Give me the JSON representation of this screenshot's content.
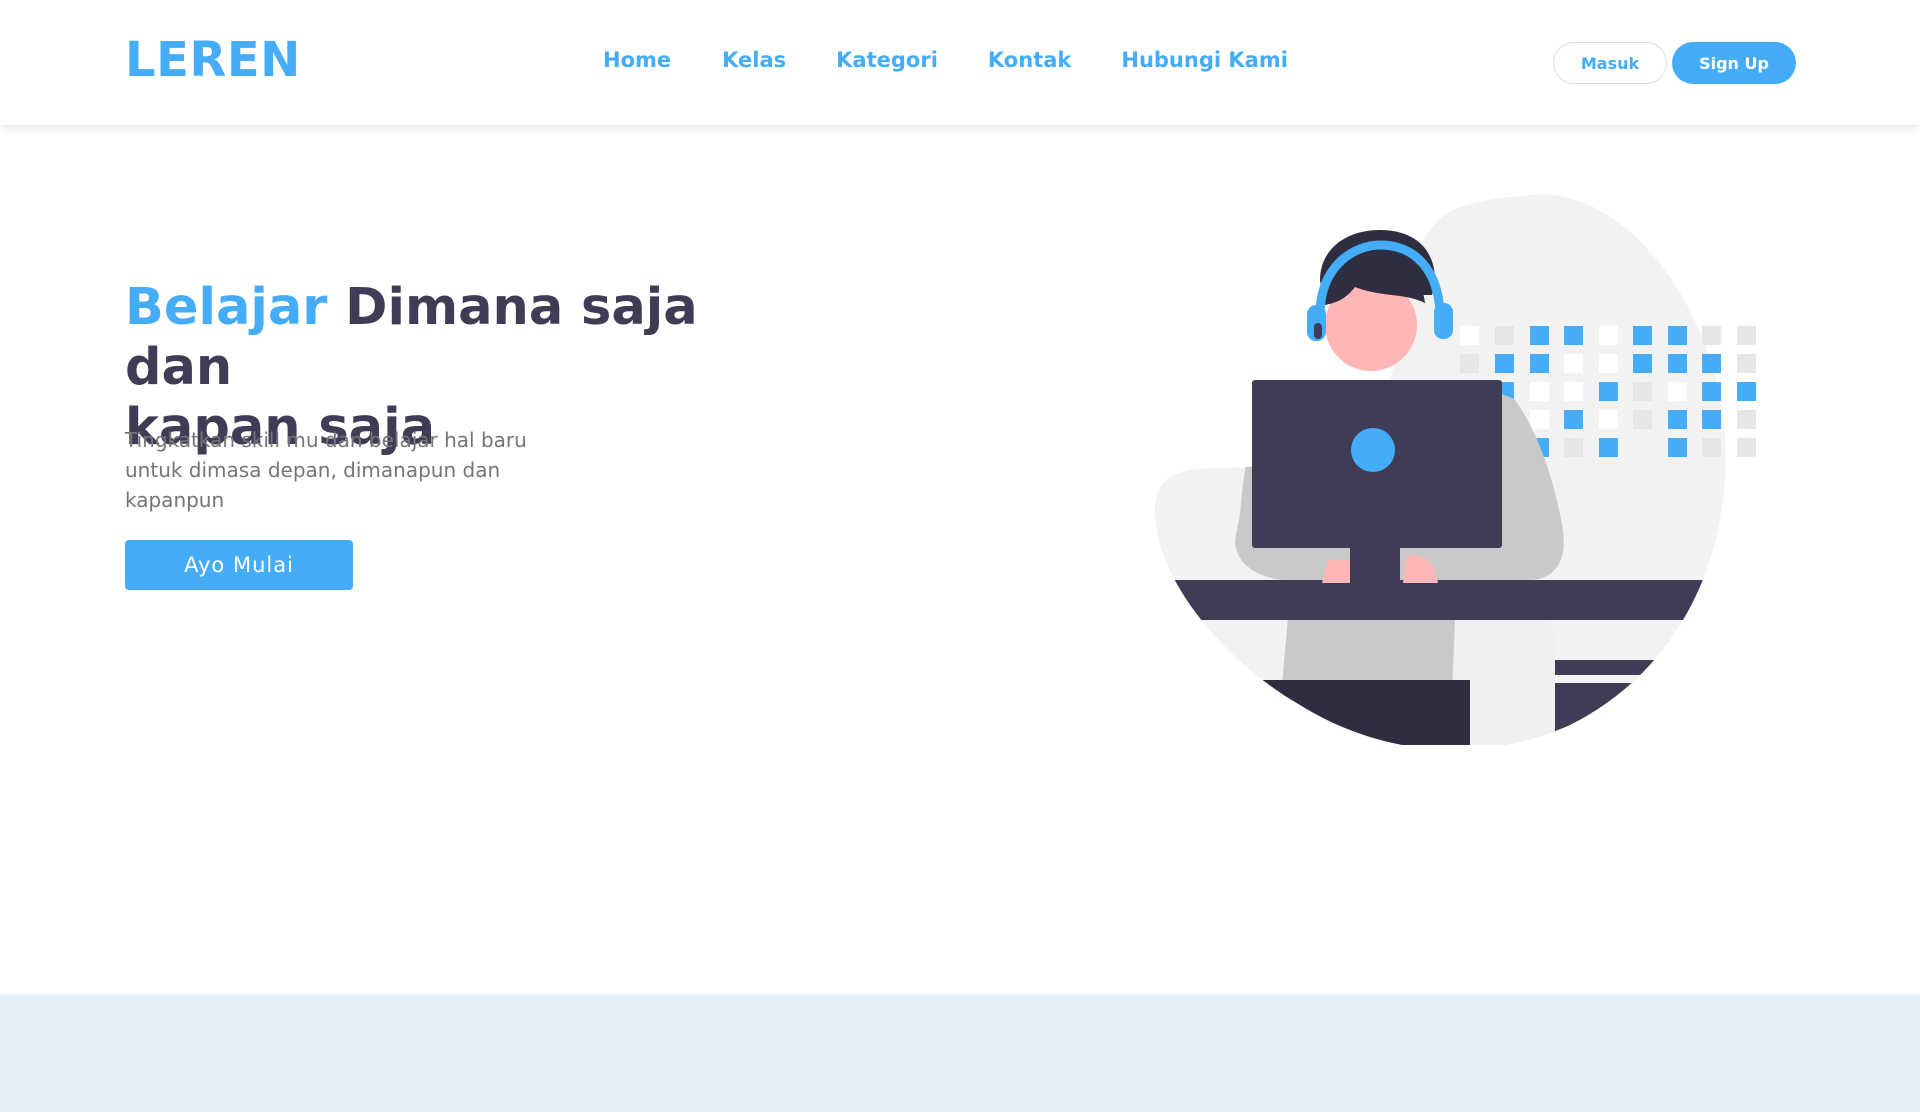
{
  "header": {
    "logo": "LEREN",
    "nav": [
      "Home",
      "Kelas",
      "Kategori",
      "Kontak",
      "Hubungi Kami"
    ],
    "login_label": "Masuk",
    "signup_label": "Sign Up"
  },
  "hero": {
    "title_accent": "Belajar",
    "title_line1": " Dimana saja dan",
    "title_line2": "kapan saja",
    "description": "Tingkatkan skill mu dan belajar hal baru untuk dimasa depan, dimanapun dan kapanpun",
    "cta_label": "Ayo Mulai"
  },
  "colors": {
    "accent": "#45adf7",
    "heading": "#3f3d56",
    "text_muted": "#757575",
    "band": "#e3f0f9"
  }
}
